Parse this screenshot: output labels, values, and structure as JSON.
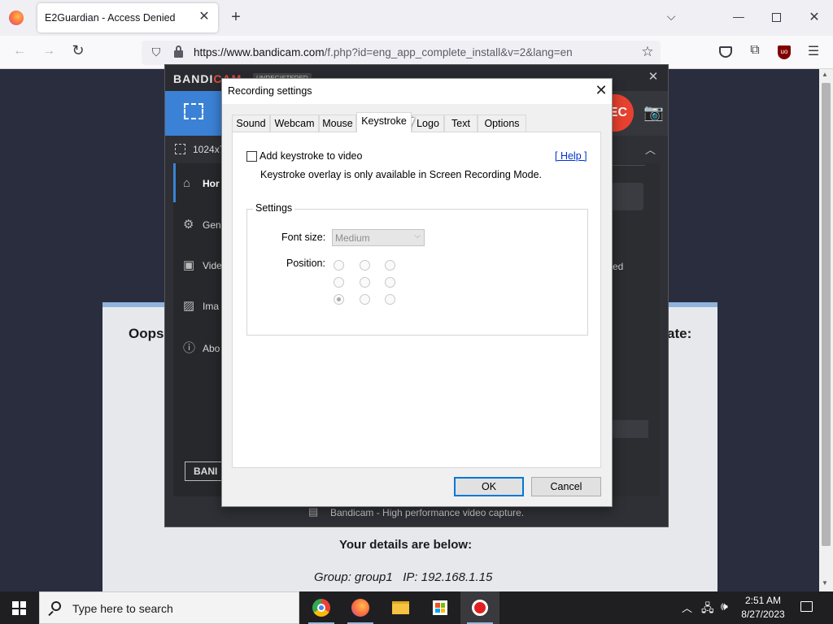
{
  "browser": {
    "tab_title": "E2Guardian - Access Denied",
    "url_host": "https://www.bandicam.com",
    "url_path": "/f.php?id=eng_app_complete_install&v=2&lang=en"
  },
  "webpage": {
    "heading_left": "Oops",
    "heading_right": "ate:",
    "details_heading": "Your details are below:",
    "details_text": "Group: group1   IP: 192.168.1.15"
  },
  "bandicam": {
    "logo_part1": "BANDI",
    "logo_part2": "CAM",
    "badge": "UNREGISTERED",
    "resolution": "1024x7",
    "rec_label": "EC",
    "sidebar": [
      {
        "label": "Hor",
        "icon": "home-icon"
      },
      {
        "label": "Gen",
        "icon": "gear-icon"
      },
      {
        "label": "Vide",
        "icon": "video-icon"
      },
      {
        "label": "Ima",
        "icon": "image-icon"
      },
      {
        "label": "Abo",
        "icon": "info-icon"
      }
    ],
    "brand_button": "BANI",
    "partial_text": "ed",
    "footer": "Bandicam - High performance video capture."
  },
  "dialog": {
    "title": "Recording settings",
    "tabs": [
      "Sound",
      "Webcam",
      "Mouse",
      "Keystroke",
      "Logo",
      "Text",
      "Options"
    ],
    "active_tab": "Keystroke",
    "add_keystroke_label": "Add keystroke to video",
    "help_link": "[ Help ]",
    "note": "Keystroke overlay is only available in Screen Recording Mode.",
    "settings_group": "Settings",
    "font_size_label": "Font size:",
    "font_size_value": "Medium",
    "position_label": "Position:",
    "ok": "OK",
    "cancel": "Cancel"
  },
  "taskbar": {
    "search_placeholder": "Type here to search",
    "time": "2:51 AM",
    "date": "8/27/2023"
  }
}
